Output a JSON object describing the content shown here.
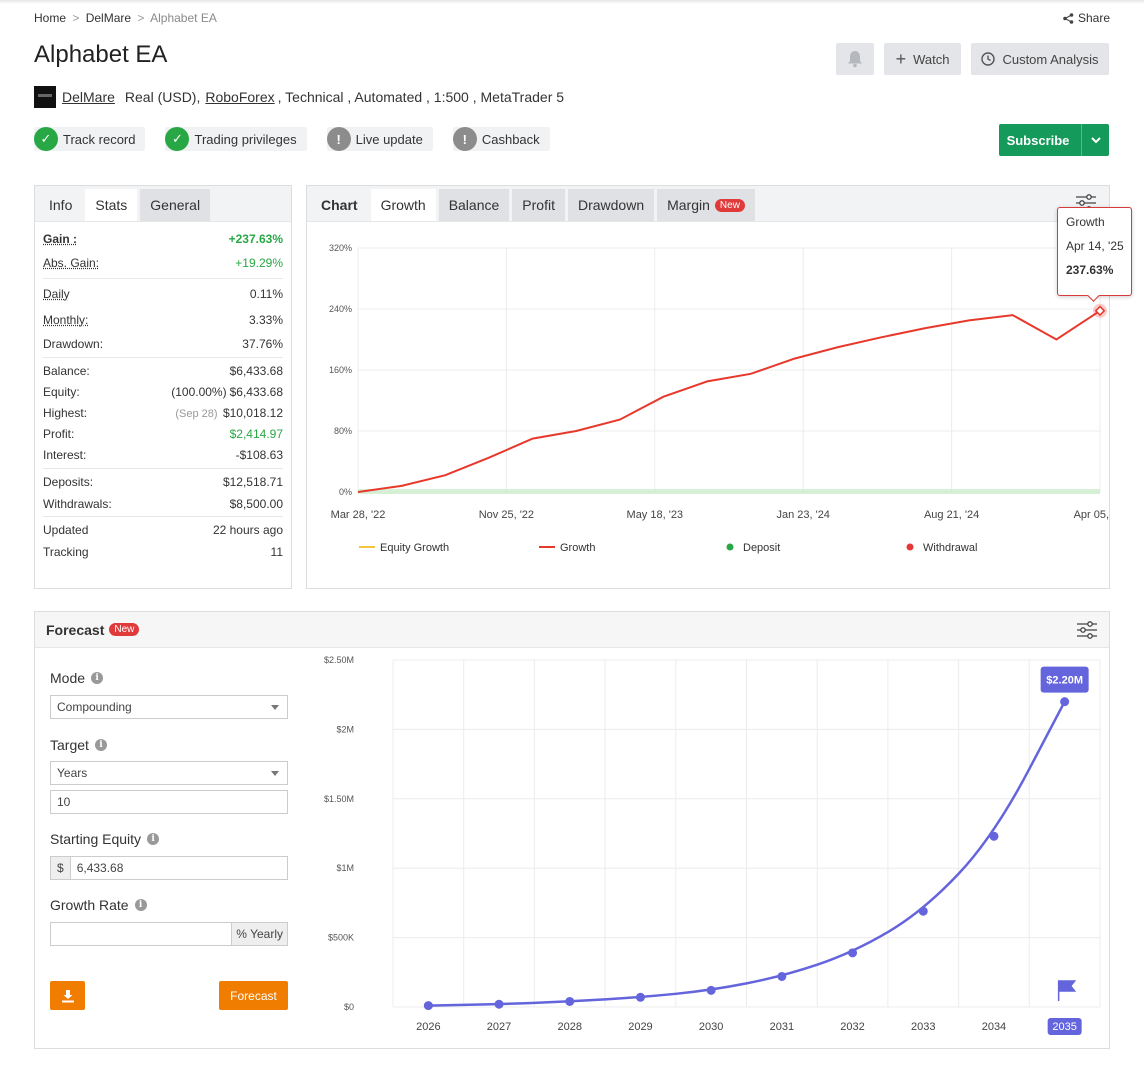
{
  "breadcrumb": {
    "home": "Home",
    "sep": ">",
    "parent": "DelMare",
    "current": "Alphabet EA"
  },
  "share": "Share",
  "title": "Alphabet EA",
  "actions": {
    "watch": "Watch",
    "custom_analysis": "Custom Analysis"
  },
  "account": {
    "owner": "DelMare",
    "type": "Real (USD),",
    "broker": "RoboForex",
    "rest": ", Technical , Automated , 1:500 , MetaTrader 5"
  },
  "badges": [
    {
      "label": "Track record",
      "status": "ok",
      "mark": "✓"
    },
    {
      "label": "Trading privileges",
      "status": "ok",
      "mark": "✓"
    },
    {
      "label": "Live update",
      "status": "warn",
      "mark": "!"
    },
    {
      "label": "Cashback",
      "status": "warn",
      "mark": "!"
    }
  ],
  "subscribe": "Subscribe",
  "stats_panel": {
    "tabs": [
      "Info",
      "Stats",
      "General"
    ],
    "rows": {
      "gain": {
        "label": "Gain :",
        "value": "+237.63%"
      },
      "abs_gain": {
        "label": "Abs. Gain:",
        "value": "+19.29%"
      },
      "daily": {
        "label": "Daily",
        "value": "0.11%"
      },
      "monthly": {
        "label": "Monthly:",
        "value": "3.33%"
      },
      "drawdown": {
        "label": "Drawdown:",
        "value": "37.76%"
      },
      "balance": {
        "label": "Balance:",
        "value": "$6,433.68"
      },
      "equity": {
        "label": "Equity:",
        "note": "(100.00%)",
        "value": "$6,433.68"
      },
      "highest": {
        "label": "Highest:",
        "note": "(Sep 28)",
        "value": "$10,018.12"
      },
      "profit": {
        "label": "Profit:",
        "value": "$2,414.97"
      },
      "interest": {
        "label": "Interest:",
        "value": "-$108.63"
      },
      "deposits": {
        "label": "Deposits:",
        "value": "$12,518.71"
      },
      "withdrawals": {
        "label": "Withdrawals:",
        "value": "$8,500.00"
      },
      "updated": {
        "label": "Updated",
        "value": "22 hours ago"
      },
      "tracking": {
        "label": "Tracking",
        "value": "11"
      }
    }
  },
  "chart_panel": {
    "tabs": [
      "Chart",
      "Growth",
      "Balance",
      "Profit",
      "Drawdown",
      "Margin"
    ],
    "new_label": "New",
    "tooltip": {
      "title": "Growth",
      "date": "Apr 14, '25",
      "value": "237.63%"
    }
  },
  "forecast": {
    "title": "Forecast",
    "new_label": "New",
    "mode_label": "Mode",
    "mode_value": "Compounding",
    "target_label": "Target",
    "target_unit": "Years",
    "target_value": "10",
    "starting_equity_label": "Starting Equity",
    "currency": "$",
    "starting_equity_value": "6,433.68",
    "growth_rate_label": "Growth Rate",
    "growth_rate_value": "",
    "growth_rate_unit": "% Yearly",
    "forecast_button": "Forecast"
  },
  "colors": {
    "growth_line": "#e8382c",
    "equity_growth": "#f5c542",
    "deposit": "#28a745",
    "withdrawal": "#e53935",
    "forecast_line": "#6464dc",
    "subscribe": "#149a5a",
    "orange": "#f07d00"
  },
  "chart_data": [
    {
      "type": "line",
      "x": [
        "Mar 28, '22",
        "Jun '22",
        "Sep '22",
        "Nov 25, '22",
        "Dec '22",
        "Mar '23",
        "May 18, '23",
        "Aug '23",
        "Nov '23",
        "Jan 23, '24",
        "Feb '24",
        "May '24",
        "Aug 21, '24",
        "Nov '24",
        "Jan '25",
        "Mar '25",
        "Apr 05, '25",
        "Apr 14, '25"
      ],
      "series": [
        {
          "name": "Growth",
          "values": [
            0,
            8,
            22,
            45,
            70,
            80,
            95,
            125,
            145,
            155,
            175,
            190,
            203,
            215,
            225,
            232,
            200,
            237.63
          ]
        }
      ],
      "legend": [
        "Equity Growth",
        "Growth",
        "Deposit",
        "Withdrawal"
      ],
      "x_ticks": [
        "Mar 28, '22",
        "Nov 25, '22",
        "May 18, '23",
        "Jan 23, '24",
        "Aug 21, '24",
        "Apr 05, '25"
      ],
      "y_ticks": [
        "0%",
        "80%",
        "160%",
        "240%",
        "320%"
      ],
      "ylim": [
        0,
        320
      ],
      "grid": true,
      "legend_position": "bottom"
    },
    {
      "type": "line",
      "categories": [
        "2026",
        "2027",
        "2028",
        "2029",
        "2030",
        "2031",
        "2032",
        "2033",
        "2034",
        "2035"
      ],
      "values": [
        10000,
        20000,
        40000,
        70000,
        120000,
        220000,
        390000,
        690000,
        1230000,
        2200000
      ],
      "y_ticks": [
        "$0",
        "$500K",
        "$1M",
        "$1.50M",
        "$2M",
        "$2.50M"
      ],
      "ylim": [
        0,
        2500000
      ],
      "last_label": "$2.20M",
      "grid": true
    }
  ]
}
